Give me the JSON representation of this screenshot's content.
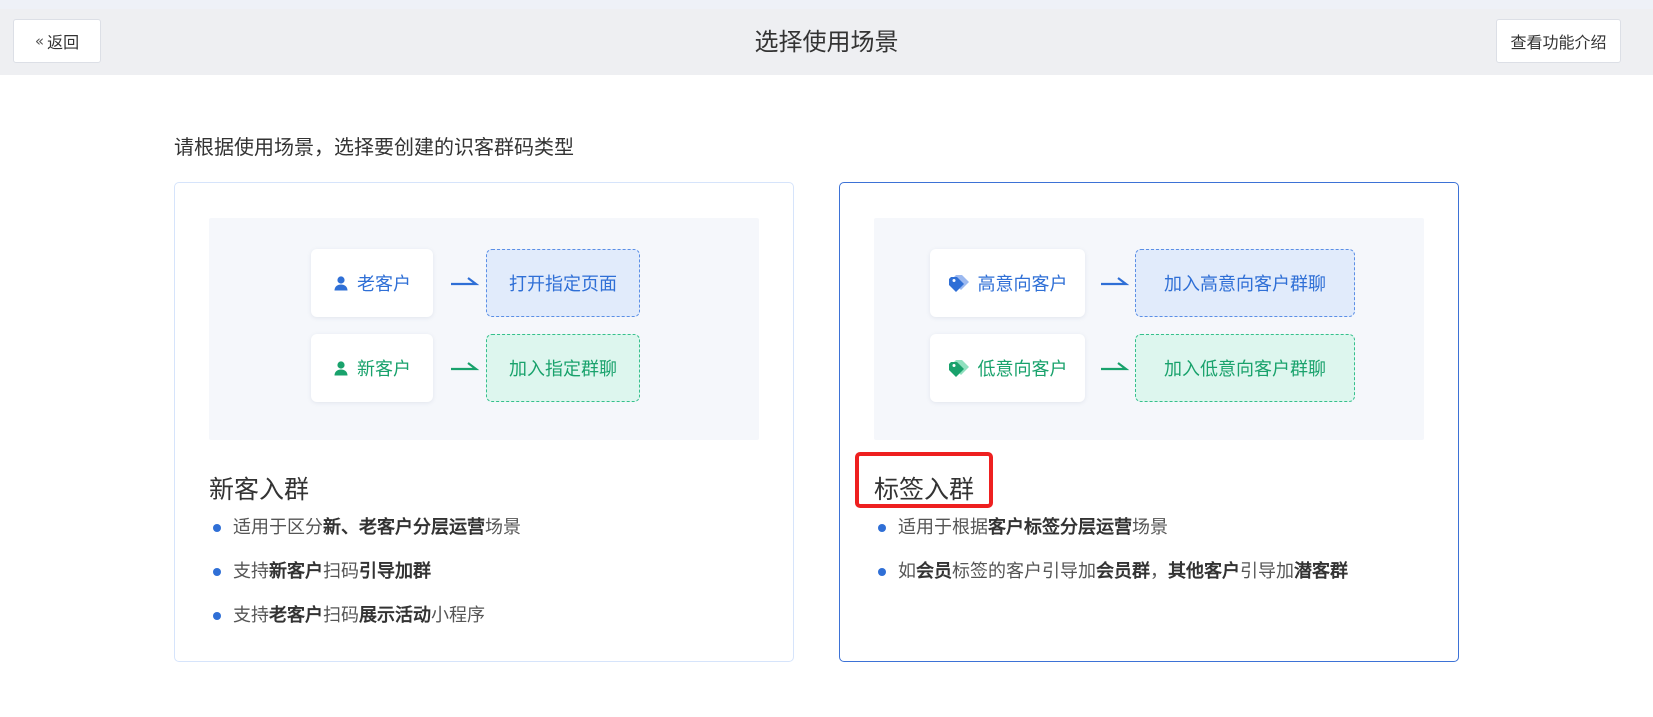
{
  "header": {
    "back_label": "返回",
    "title": "选择使用场景",
    "intro_label": "查看功能介绍"
  },
  "subtitle": "请根据使用场景，选择要创建的识客群码类型",
  "cards": [
    {
      "title": "新客入群",
      "flows": [
        {
          "source": "老客户",
          "source_icon": "user-icon",
          "target": "打开指定页面",
          "color": "#2f6fd6"
        },
        {
          "source": "新客户",
          "source_icon": "user-icon",
          "target": "加入指定群聊",
          "color": "#19a26c"
        }
      ],
      "bullets": [
        [
          {
            "t": "适用于区分",
            "b": false
          },
          {
            "t": "新、老客户分层运营",
            "b": true
          },
          {
            "t": "场景",
            "b": false
          }
        ],
        [
          {
            "t": "支持",
            "b": false
          },
          {
            "t": "新客户",
            "b": true
          },
          {
            "t": "扫码",
            "b": false
          },
          {
            "t": "引导加群",
            "b": true
          }
        ],
        [
          {
            "t": "支持",
            "b": false
          },
          {
            "t": "老客户",
            "b": true
          },
          {
            "t": "扫码",
            "b": false
          },
          {
            "t": "展示活动",
            "b": true
          },
          {
            "t": "小程序",
            "b": false
          }
        ]
      ]
    },
    {
      "title": "标签入群",
      "selected": true,
      "flows": [
        {
          "source": "高意向客户",
          "source_icon": "tag-icon",
          "target": "加入高意向客户群聊",
          "color": "#2f6fd6"
        },
        {
          "source": "低意向客户",
          "source_icon": "tag-icon",
          "target": "加入低意向客户群聊",
          "color": "#19a26c"
        }
      ],
      "bullets": [
        [
          {
            "t": "适用于根据",
            "b": false
          },
          {
            "t": "客户标签分层运营",
            "b": true
          },
          {
            "t": "场景",
            "b": false
          }
        ],
        [
          {
            "t": "如",
            "b": false
          },
          {
            "t": "会员",
            "b": true
          },
          {
            "t": "标签的客户引导加",
            "b": false
          },
          {
            "t": "会员群",
            "b": true
          },
          {
            "t": "，",
            "b": false
          },
          {
            "t": "其他客户",
            "b": true
          },
          {
            "t": "引导加",
            "b": false
          },
          {
            "t": "潜客群",
            "b": true
          }
        ]
      ]
    }
  ]
}
